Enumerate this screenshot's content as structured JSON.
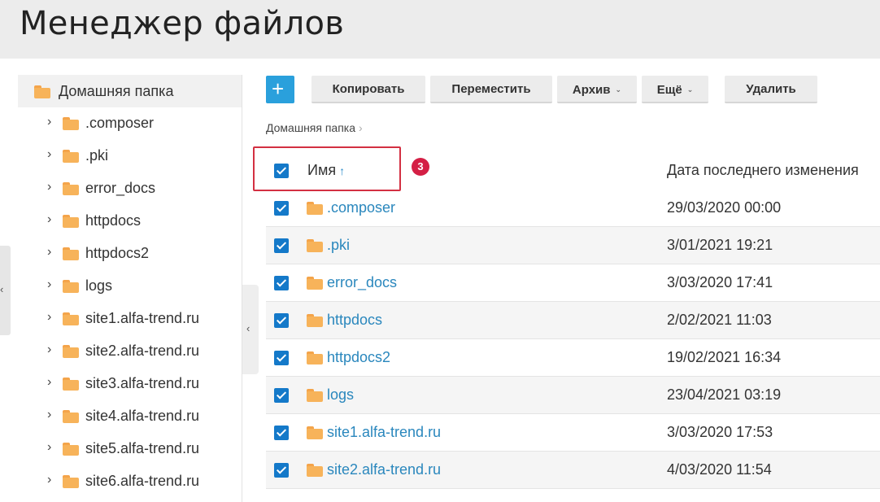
{
  "page": {
    "title": "Менеджер файлов"
  },
  "tree": {
    "root_label": "Домашняя папка",
    "items": [
      {
        "label": ".composer"
      },
      {
        "label": ".pki"
      },
      {
        "label": "error_docs"
      },
      {
        "label": "httpdocs"
      },
      {
        "label": "httpdocs2"
      },
      {
        "label": "logs"
      },
      {
        "label": "site1.alfa-trend.ru"
      },
      {
        "label": "site2.alfa-trend.ru"
      },
      {
        "label": "site3.alfa-trend.ru"
      },
      {
        "label": "site4.alfa-trend.ru"
      },
      {
        "label": "site5.alfa-trend.ru"
      },
      {
        "label": "site6.alfa-trend.ru"
      }
    ]
  },
  "toolbar": {
    "add_label": "+",
    "copy_label": "Копировать",
    "move_label": "Переместить",
    "archive_label": "Архив",
    "more_label": "Ещё",
    "delete_label": "Удалить"
  },
  "breadcrumb": {
    "home": "Домашняя папка"
  },
  "table": {
    "name_header": "Имя",
    "sort_arrow": "↑",
    "date_header": "Дата последнего изменения",
    "rows": [
      {
        "name": ".composer",
        "date": "29/03/2020 00:00"
      },
      {
        "name": ".pki",
        "date": "3/01/2021 19:21"
      },
      {
        "name": "error_docs",
        "date": "3/03/2020 17:41"
      },
      {
        "name": "httpdocs",
        "date": "2/02/2021 11:03"
      },
      {
        "name": "httpdocs2",
        "date": "19/02/2021 16:34"
      },
      {
        "name": "logs",
        "date": "23/04/2021 03:19"
      },
      {
        "name": "site1.alfa-trend.ru",
        "date": "3/03/2020 17:53"
      },
      {
        "name": "site2.alfa-trend.ru",
        "date": "4/03/2020 11:54"
      }
    ]
  },
  "annotation": {
    "badge": "3"
  },
  "colors": {
    "accent": "#2aa0dc",
    "checkbox": "#1479c9",
    "link": "#2a87bd",
    "folder": "#f7b35a",
    "highlight": "#d33042"
  }
}
